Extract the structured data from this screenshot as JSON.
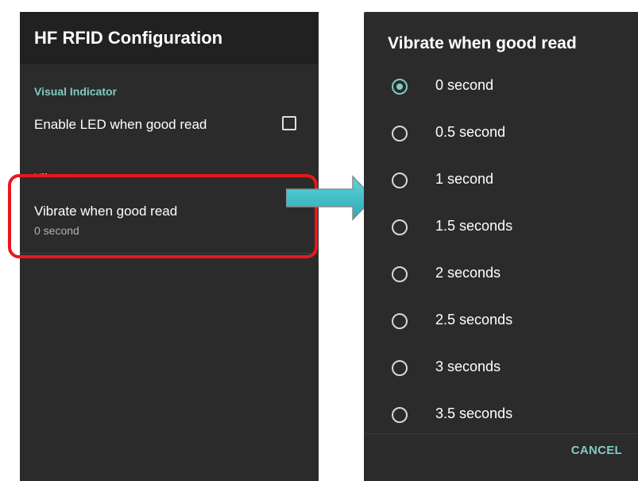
{
  "settings": {
    "title": "HF RFID Configuration",
    "visual_indicator_header": "Visual Indicator",
    "led_label": "Enable LED when good read",
    "vibrator_header": "Vibrator",
    "vibrate_label": "Vibrate when good read",
    "vibrate_value": "0 second",
    "led_checked": false
  },
  "dialog": {
    "title": "Vibrate when good read",
    "options": [
      "0 second",
      "0.5 second",
      "1 second",
      "1.5 seconds",
      "2 seconds",
      "2.5 seconds",
      "3 seconds",
      "3.5 seconds"
    ],
    "selected_index": 0,
    "cancel_label": "CANCEL"
  },
  "colors": {
    "accent": "#80cbc4",
    "highlight": "#e8171d",
    "arrow": "#3fc1c9",
    "background": "#2b2b2b"
  }
}
